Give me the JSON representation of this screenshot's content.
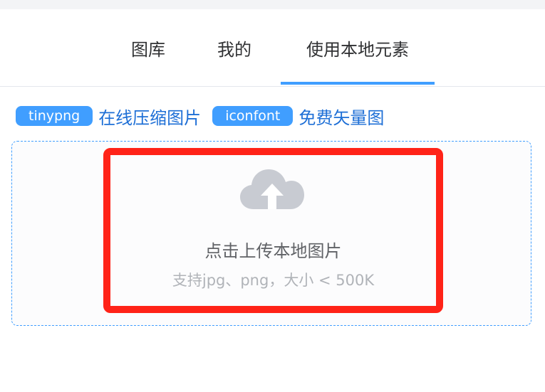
{
  "tabs": [
    {
      "label": "图库"
    },
    {
      "label": "我的"
    },
    {
      "label": "使用本地元素",
      "active": true
    }
  ],
  "tools": {
    "tinypng_tag": "tinypng",
    "tinypng_text": "在线压缩图片",
    "iconfont_tag": "iconfont",
    "iconfont_text": "免费矢量图"
  },
  "upload": {
    "icon": "cloud-upload-icon",
    "title": "点击上传本地图片",
    "hint": "支持jpg、png，大小 < 500K"
  },
  "colors": {
    "accent": "#409eff",
    "highlight": "#ff2318",
    "link": "#1e6fd6",
    "icon": "#c8cbd2"
  }
}
